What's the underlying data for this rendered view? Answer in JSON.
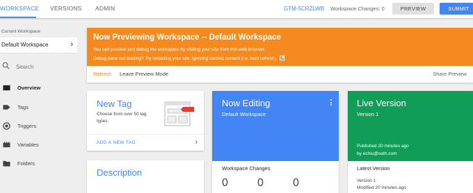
{
  "topbar": {
    "tabs": [
      {
        "label": "WORKSPACE",
        "active": true
      },
      {
        "label": "VERSIONS",
        "active": false
      },
      {
        "label": "ADMIN",
        "active": false
      }
    ],
    "container_id": "GTM-5CRZLWB",
    "workspace_changes": "Workspace Changes: 0",
    "preview_label": "PREVIEW",
    "submit_label": "SUBMIT"
  },
  "sidebar": {
    "current_workspace_label": "Current Workspace",
    "current_workspace_name": "Default Workspace",
    "search_placeholder": "Search",
    "items": [
      {
        "label": "Overview",
        "icon": "overview-icon",
        "active": true
      },
      {
        "label": "Tags",
        "icon": "tag-icon",
        "active": false
      },
      {
        "label": "Triggers",
        "icon": "trigger-icon",
        "active": false
      },
      {
        "label": "Variables",
        "icon": "variables-icon",
        "active": false
      },
      {
        "label": "Folders",
        "icon": "folder-icon",
        "active": false
      }
    ]
  },
  "preview_banner": {
    "title": "Now Previewing Workspace -- Default Workspace",
    "line1": "You can preview and debug the workspace by visiting your site from this web browser.",
    "line2": "Debug pane not loading? Try reloading your site, ignoring cached content (i.e. hard refresh).",
    "refresh_label": "Refresh",
    "leave_label": "Leave Preview Mode",
    "share_label": "Share Preview"
  },
  "new_tag_card": {
    "title": "New Tag",
    "description": "Choose from over 50 tag types.",
    "action_label": "ADD A NEW TAG"
  },
  "description_card": {
    "title": "Description"
  },
  "now_editing_card": {
    "title": "Now Editing",
    "workspace": "Default Workspace",
    "changes_label": "Workspace Changes",
    "counts": [
      "0",
      "0",
      "0"
    ]
  },
  "live_version_card": {
    "title": "Live Version",
    "version": "Version 1",
    "published": "Published 20 minutes ago",
    "published_by": "by echiu@oath.com",
    "latest_label": "Latest Version",
    "latest_version": "Version 1",
    "latest_modified": "Modified 20 minutes ago"
  },
  "colors": {
    "accent_blue": "#4285f4",
    "banner_orange": "#f68a1e",
    "live_green": "#0f9d58",
    "background": "#eeeeee"
  }
}
